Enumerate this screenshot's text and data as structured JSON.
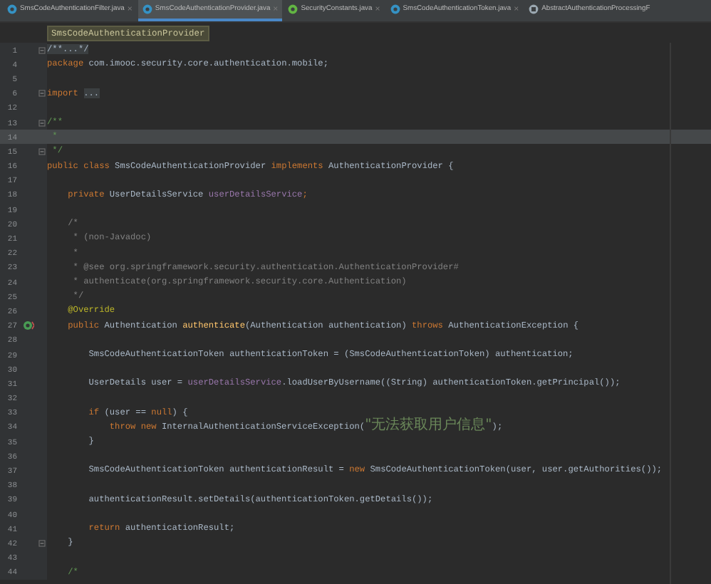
{
  "tabs": [
    {
      "label": "SmsCodeAuthenticationFilter.java",
      "kind": "class",
      "selected": false,
      "close": "×"
    },
    {
      "label": "SmsCodeAuthenticationProvider.java",
      "kind": "class",
      "selected": true,
      "close": "×"
    },
    {
      "label": "SecurityConstants.java",
      "kind": "interface",
      "selected": false,
      "close": "×"
    },
    {
      "label": "SmsCodeAuthenticationToken.java",
      "kind": "class",
      "selected": false,
      "close": "×"
    },
    {
      "label": "AbstractAuthenticationProcessingF",
      "kind": "abstract",
      "selected": false
    }
  ],
  "breadcrumb": "SmsCodeAuthenticationProvider",
  "lines": [
    {
      "number": "1",
      "kind": "fold",
      "current": false,
      "tokens": [
        {
          "kind": "folded",
          "text": "/**...*/"
        }
      ]
    },
    {
      "number": "4",
      "current": false,
      "tokens": [
        {
          "kind": "keyword",
          "text": "package "
        },
        {
          "kind": "plain",
          "text": "com.imooc.security.core.authentication.mobile;"
        }
      ]
    },
    {
      "number": "5",
      "current": false
    },
    {
      "number": "6",
      "kind": "fold",
      "current": false,
      "tokens": [
        {
          "kind": "keyword",
          "text": "import "
        },
        {
          "kind": "folded",
          "text": "..."
        }
      ]
    },
    {
      "number": "12",
      "current": false
    },
    {
      "number": "13",
      "kind": "fold",
      "current": false,
      "tokens": [
        {
          "kind": "doc",
          "text": "/**"
        }
      ]
    },
    {
      "number": "14",
      "current": true,
      "tokens": [
        {
          "kind": "doc",
          "text": " *"
        }
      ]
    },
    {
      "number": "15",
      "kind": "fold",
      "current": false,
      "tokens": [
        {
          "kind": "doc",
          "text": " */"
        }
      ]
    },
    {
      "number": "16",
      "current": false,
      "tokens": [
        {
          "kind": "keyword",
          "text": "public class "
        },
        {
          "kind": "plain",
          "text": "SmsCodeAuthenticationProvider "
        },
        {
          "kind": "keyword",
          "text": "implements "
        },
        {
          "kind": "plain",
          "text": "AuthenticationProvider {"
        }
      ]
    },
    {
      "number": "17",
      "current": false
    },
    {
      "number": "18",
      "current": false,
      "tokens": [
        {
          "kind": "keyword",
          "text": "    private "
        },
        {
          "kind": "plain",
          "text": "UserDetailsService "
        },
        {
          "kind": "field",
          "text": "userDetailsService"
        },
        {
          "kind": "keyword",
          "text": ";"
        }
      ]
    },
    {
      "number": "19",
      "current": false
    },
    {
      "number": "20",
      "current": false,
      "tokens": [
        {
          "kind": "comment",
          "text": "    /*"
        }
      ]
    },
    {
      "number": "21",
      "current": false,
      "tokens": [
        {
          "kind": "comment",
          "text": "     * (non-Javadoc)"
        }
      ]
    },
    {
      "number": "22",
      "current": false,
      "tokens": [
        {
          "kind": "comment",
          "text": "     *"
        }
      ]
    },
    {
      "number": "23",
      "current": false,
      "tokens": [
        {
          "kind": "comment",
          "text": "     * @see org.springframework.security.authentication.AuthenticationProvider#"
        }
      ]
    },
    {
      "number": "24",
      "current": false,
      "tokens": [
        {
          "kind": "comment",
          "text": "     * authenticate(org.springframework.security.core.Authentication)"
        }
      ]
    },
    {
      "number": "25",
      "current": false,
      "tokens": [
        {
          "kind": "comment",
          "text": "     */"
        }
      ]
    },
    {
      "number": "26",
      "current": false,
      "tokens": [
        {
          "kind": "annotation",
          "text": "    @Override"
        }
      ]
    },
    {
      "number": "27",
      "kind": "override",
      "current": false,
      "tokens": [
        {
          "kind": "keyword",
          "text": "    public "
        },
        {
          "kind": "plain",
          "text": "Authentication "
        },
        {
          "kind": "method",
          "text": "authenticate"
        },
        {
          "kind": "plain",
          "text": "(Authentication authentication) "
        },
        {
          "kind": "keyword",
          "text": "throws "
        },
        {
          "kind": "plain",
          "text": "AuthenticationException {"
        }
      ]
    },
    {
      "number": "28",
      "current": false
    },
    {
      "number": "29",
      "current": false,
      "tokens": [
        {
          "kind": "plain",
          "text": "        SmsCodeAuthenticationToken authenticationToken = (SmsCodeAuthenticationToken) authentication;"
        }
      ]
    },
    {
      "number": "30",
      "current": false
    },
    {
      "number": "31",
      "current": false,
      "tokens": [
        {
          "kind": "plain",
          "text": "        UserDetails user = "
        },
        {
          "kind": "field",
          "text": "userDetailsService"
        },
        {
          "kind": "plain",
          "text": ".loadUserByUsername((String) authenticationToken.getPrincipal());"
        }
      ]
    },
    {
      "number": "32",
      "current": false
    },
    {
      "number": "33",
      "current": false,
      "tokens": [
        {
          "kind": "keyword",
          "text": "        if "
        },
        {
          "kind": "plain",
          "text": "(user == "
        },
        {
          "kind": "keyword",
          "text": "null"
        },
        {
          "kind": "plain",
          "text": ") {"
        }
      ]
    },
    {
      "number": "34",
      "current": false,
      "tokens": [
        {
          "kind": "keyword",
          "text": "            throw new "
        },
        {
          "kind": "plain",
          "text": "InternalAuthenticationServiceException("
        },
        {
          "kind": "string",
          "text": "\"无法获取用户信息\""
        },
        {
          "kind": "plain",
          "text": ");"
        }
      ]
    },
    {
      "number": "35",
      "current": false,
      "tokens": [
        {
          "kind": "plain",
          "text": "        }"
        }
      ]
    },
    {
      "number": "36",
      "current": false
    },
    {
      "number": "37",
      "current": false,
      "tokens": [
        {
          "kind": "plain",
          "text": "        SmsCodeAuthenticationToken authenticationResult = "
        },
        {
          "kind": "keyword",
          "text": "new "
        },
        {
          "kind": "plain",
          "text": "SmsCodeAuthenticationToken(user, user.getAuthorities());"
        }
      ]
    },
    {
      "number": "38",
      "current": false
    },
    {
      "number": "39",
      "current": false,
      "tokens": [
        {
          "kind": "plain",
          "text": "        authenticationResult.setDetails(authenticationToken.getDetails());"
        }
      ]
    },
    {
      "number": "40",
      "current": false
    },
    {
      "number": "41",
      "current": false,
      "tokens": [
        {
          "kind": "keyword",
          "text": "        return "
        },
        {
          "kind": "plain",
          "text": "authenticationResult;"
        }
      ]
    },
    {
      "number": "42",
      "kind": "fold",
      "current": false,
      "tokens": [
        {
          "kind": "plain",
          "text": "    }"
        }
      ]
    },
    {
      "number": "43",
      "current": false
    },
    {
      "number": "44",
      "current": false,
      "tokens": [
        {
          "kind": "doc",
          "text": "    /*"
        }
      ]
    }
  ]
}
